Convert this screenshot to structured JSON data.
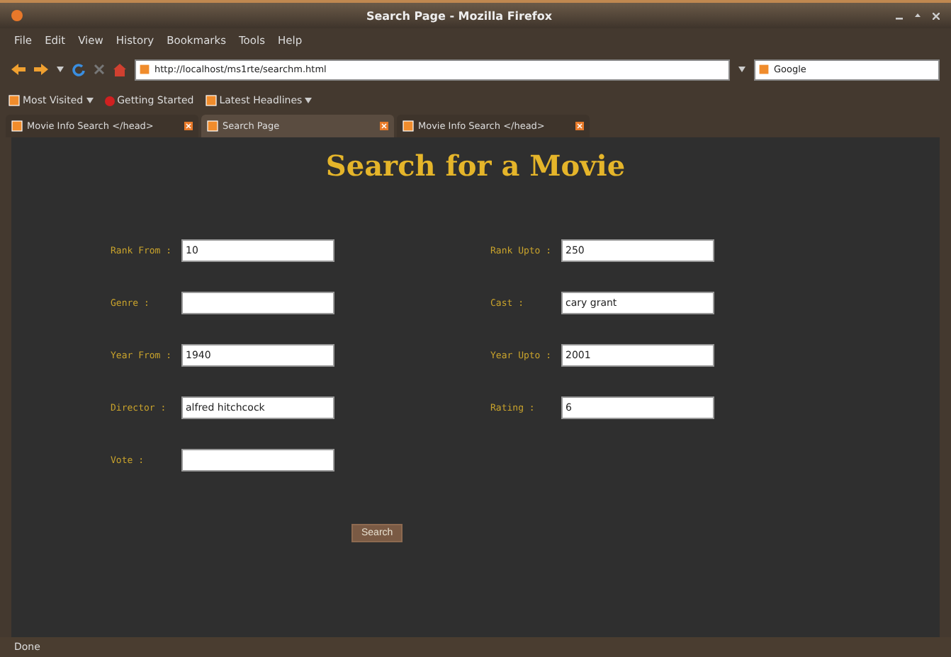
{
  "window": {
    "title": "Search Page - Mozilla Firefox"
  },
  "menu": [
    "File",
    "Edit",
    "View",
    "History",
    "Bookmarks",
    "Tools",
    "Help"
  ],
  "address_bar": {
    "url": "http://localhost/ms1rte/searchm.html"
  },
  "search_bar": {
    "placeholder": "Google"
  },
  "bookmarks": [
    {
      "label": "Most Visited",
      "dropdown": true
    },
    {
      "label": "Getting Started",
      "dropdown": false
    },
    {
      "label": "Latest Headlines",
      "dropdown": true
    }
  ],
  "tabs": [
    {
      "label": "Movie Info Search </head>",
      "selected": false
    },
    {
      "label": "Search Page",
      "selected": true
    },
    {
      "label": "Movie Info Search </head>",
      "selected": false
    }
  ],
  "page": {
    "heading": "Search for a Movie",
    "fields": [
      {
        "label": "Rank From :",
        "value": "10"
      },
      {
        "label": "Rank Upto :",
        "value": "250"
      },
      {
        "label": "Genre :"
      },
      {
        "label": "Cast :",
        "value": "cary grant"
      },
      {
        "label": "Year From :",
        "value": "1940"
      },
      {
        "label": "Year Upto :",
        "value": "2001"
      },
      {
        "label": "Director :",
        "value": "alfred hitchcock"
      },
      {
        "label": "Rating :",
        "value": "6"
      },
      {
        "label": "Vote :"
      }
    ],
    "button": "Search"
  },
  "status_bar": {
    "text": "Done"
  }
}
